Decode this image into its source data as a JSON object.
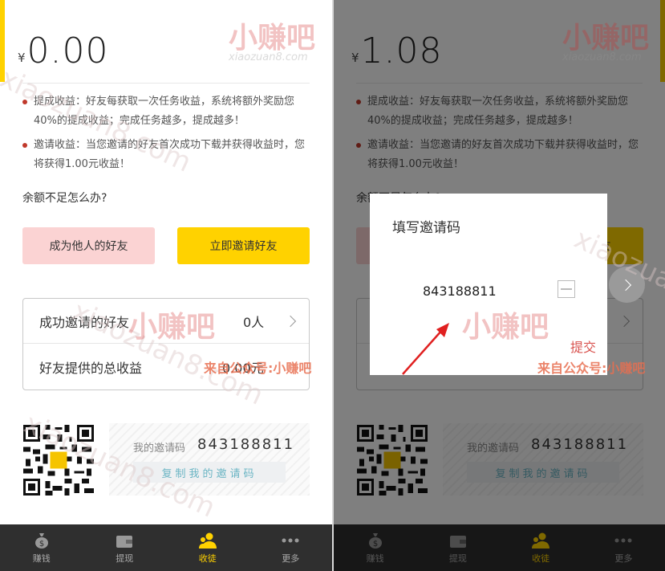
{
  "balance_left": {
    "currency": "¥",
    "amount": "0.00"
  },
  "balance_right": {
    "currency": "¥",
    "amount": "1.08"
  },
  "bullets": [
    "提成收益：好友每获取一次任务收益，系统将额外奖励您40%的提成收益；完成任务越多，提成越多！",
    "邀请收益：当您邀请的好友首次成功下载并获得收益时，您将获得1.00元收益！"
  ],
  "question": "余额不足怎么办?",
  "buttons": {
    "become_friend": "成为他人的好友",
    "invite_now": "立即邀请好友"
  },
  "stats": {
    "invited_label": "成功邀请的好友",
    "invited_value": "0人",
    "earnings_label": "好友提供的总收益",
    "earnings_value": "0.00元"
  },
  "invite": {
    "code_label": "我的邀请码",
    "code": "843188811",
    "copy_label": "复制我的邀请码"
  },
  "tabs": [
    {
      "label": "赚钱",
      "icon": "money-bag-icon"
    },
    {
      "label": "提现",
      "icon": "wallet-icon"
    },
    {
      "label": "收徒",
      "icon": "apprentice-icon",
      "active": true
    },
    {
      "label": "更多",
      "icon": "more-icon"
    }
  ],
  "dialog": {
    "title": "填写邀请码",
    "code": "843188811",
    "submit": "提交"
  },
  "watermark": {
    "brand": "小赚吧",
    "domain": "xiaozuan8.com",
    "source": "来自公众号:小赚吧"
  },
  "colors": {
    "accent": "#ffd200",
    "pink": "#fbd3d3",
    "tabbar": "#2f2f2f",
    "submit": "#d9534f"
  }
}
